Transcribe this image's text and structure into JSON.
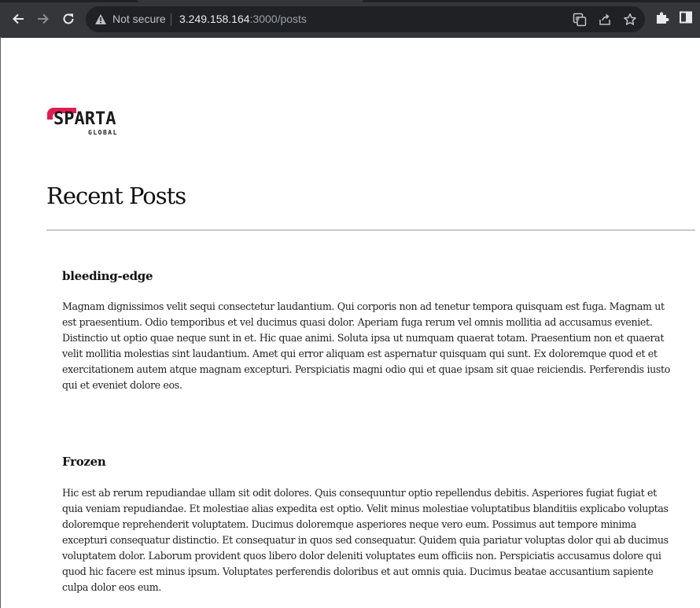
{
  "browser": {
    "security_label": "Not secure",
    "url_host": "3.249.158.164",
    "url_rest": ":3000/posts"
  },
  "page": {
    "logo_text": "SPARTA",
    "logo_subtext": "GLOBAL",
    "title": "Recent Posts"
  },
  "posts": [
    {
      "title": "bleeding-edge",
      "body": "Magnam dignissimos velit sequi consectetur laudantium. Qui corporis non ad tenetur tempora quisquam est fuga. Magnam ut est praesentium. Odio temporibus et vel ducimus quasi dolor. Aperiam fuga rerum vel omnis mollitia ad accusamus eveniet. Distinctio ut optio quae neque sunt in et. Hic quae animi. Soluta ipsa ut numquam quaerat totam. Praesentium non et quaerat velit mollitia molestias sint laudantium. Amet qui error aliquam est aspernatur quisquam qui sunt. Ex doloremque quod et et exercitationem autem atque magnam excepturi. Perspiciatis magni odio qui et quae ipsam sit quae reiciendis. Perferendis iusto qui et eveniet dolore eos."
    },
    {
      "title": "Frozen",
      "body": "Hic est ab rerum repudiandae ullam sit odit dolores. Quis consequuntur optio repellendus debitis. Asperiores fugiat fugiat et quia veniam repudiandae. Et molestiae alias expedita est optio. Velit minus molestiae voluptatibus blanditiis explicabo voluptas doloremque reprehenderit voluptatem. Ducimus doloremque asperiores neque vero eum. Possimus aut tempore minima excepturi consequatur distinctio. Et consequatur in quos sed consequatur. Quidem quia pariatur voluptas dolor qui ab ducimus voluptatem dolor. Laborum provident quos libero dolor deleniti voluptates eum officiis non. Perspiciatis accusamus dolore qui quod hic facere est minus ipsum. Voluptates perferendis doloribus et aut omnis quia. Ducimus beatae accusantium sapiente culpa dolor eos eum."
    }
  ],
  "colors": {
    "brand_accent": "#e31b4f",
    "chrome_bg": "#35363a",
    "omnibox_bg": "#202124"
  }
}
